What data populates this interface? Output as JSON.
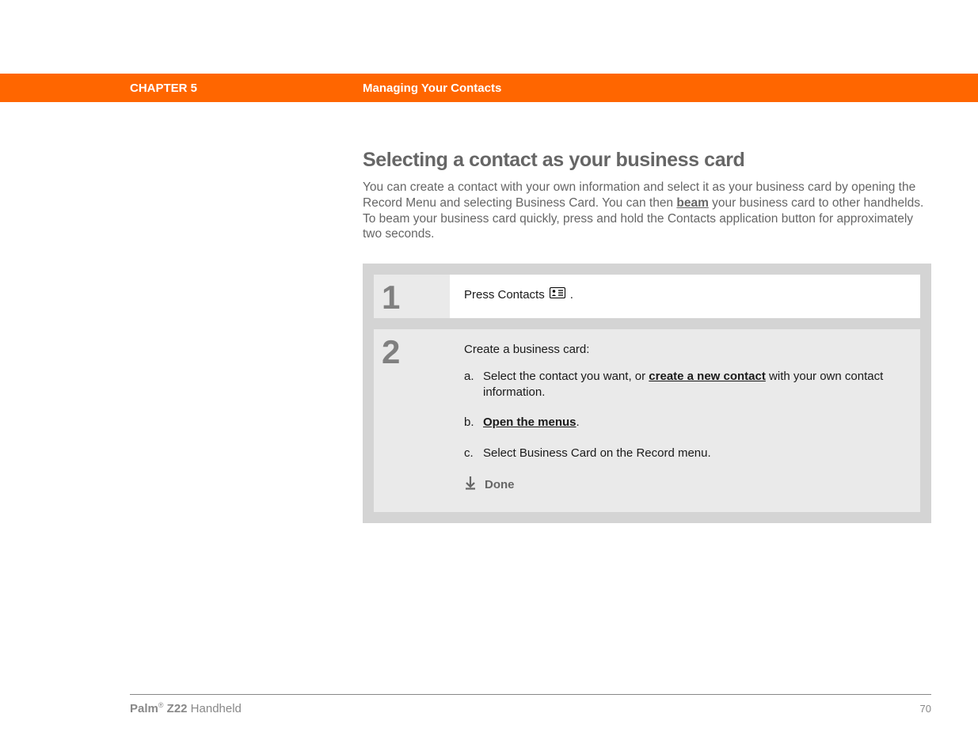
{
  "header": {
    "chapter": "CHAPTER 5",
    "title": "Managing Your Contacts"
  },
  "section": {
    "heading": "Selecting a contact as your business card",
    "intro_before_link": "You can create a contact with your own information and select it as your business card by opening the Record Menu and selecting Business Card. You can then ",
    "intro_link": "beam",
    "intro_after_link": " your business card to other handhelds. To beam your business card quickly, press and hold the Contacts application button for approximately two seconds."
  },
  "steps": {
    "step1": {
      "num": "1",
      "text_before": "Press Contacts ",
      "text_after": "."
    },
    "step2": {
      "num": "2",
      "lead": "Create a business card:",
      "a_letter": "a.",
      "a_before": "Select the contact you want, or ",
      "a_link": "create a new contact",
      "a_after": " with your own contact information.",
      "b_letter": "b.",
      "b_link": "Open the menus",
      "b_after": ".",
      "c_letter": "c.",
      "c_text": "Select Business Card on the Record menu.",
      "done": "Done"
    }
  },
  "footer": {
    "brand": "Palm",
    "reg": "®",
    "model": " Z22",
    "product": " Handheld",
    "page": "70"
  }
}
